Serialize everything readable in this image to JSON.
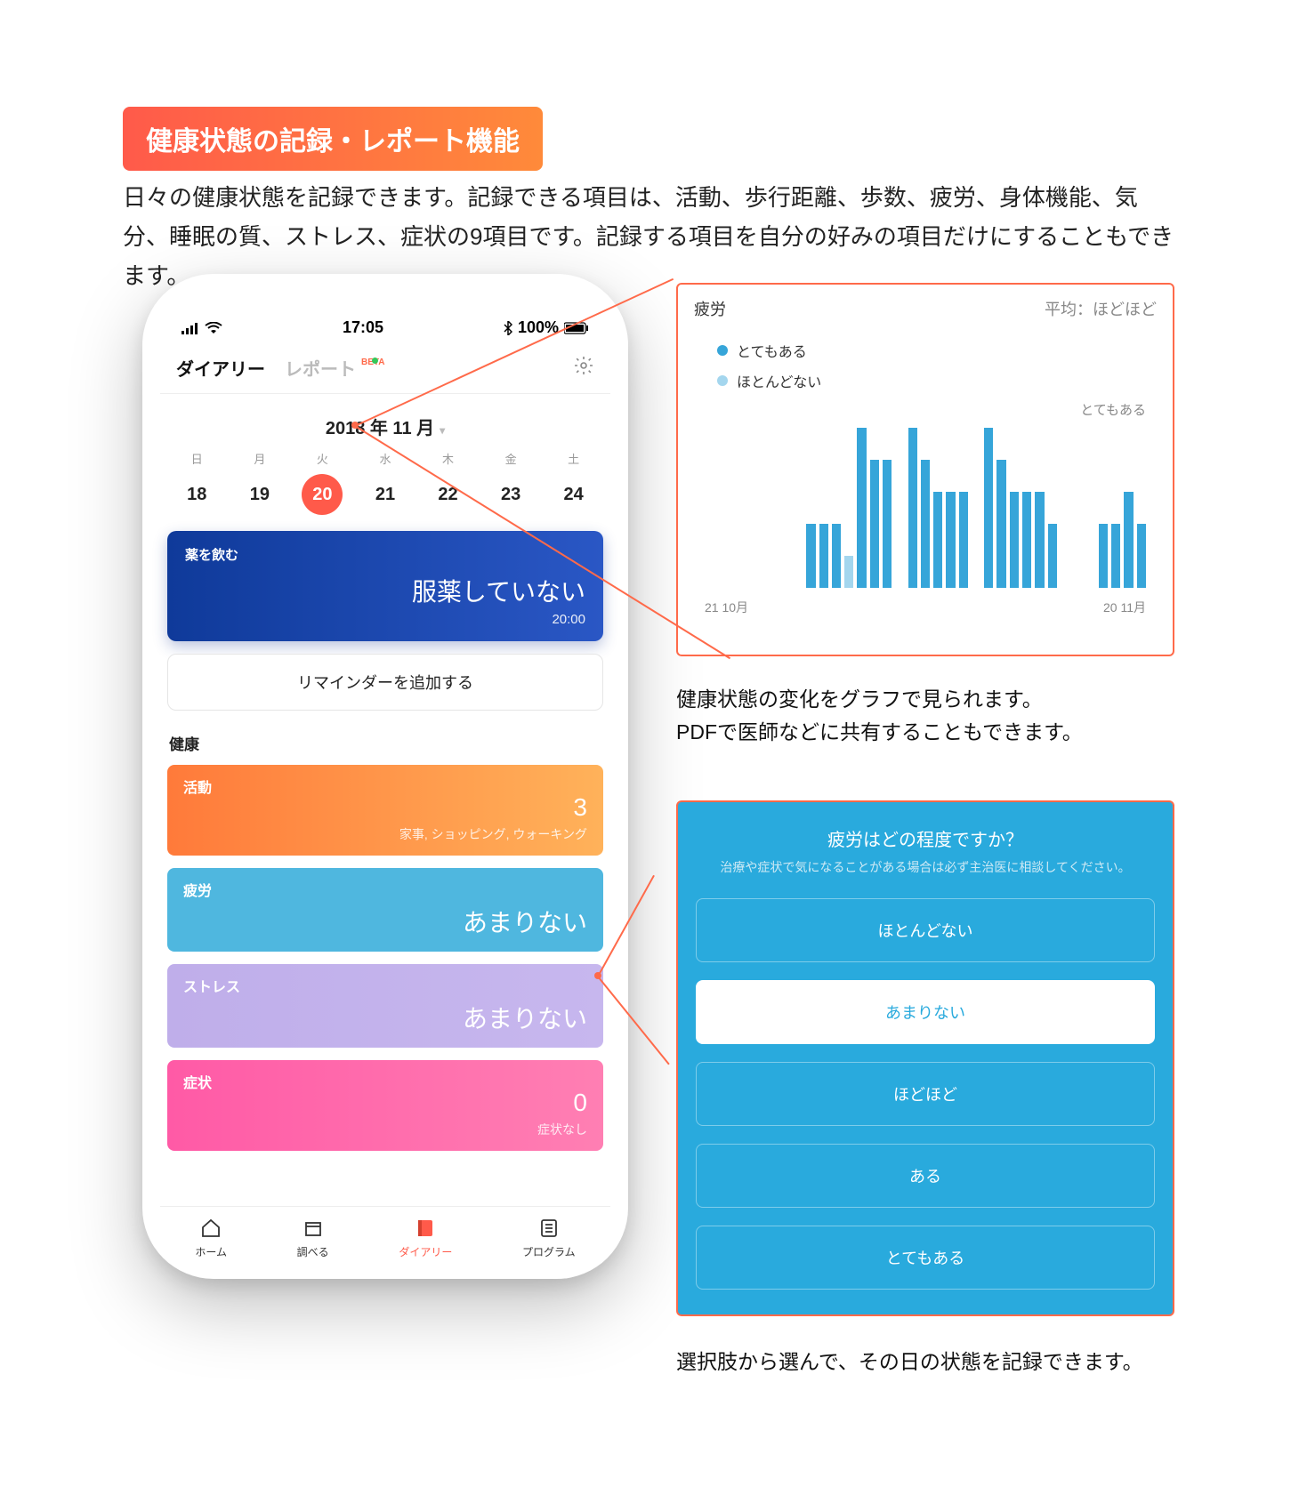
{
  "title": "健康状態の記録・レポート機能",
  "intro": "日々の健康状態を記録できます。記録できる項目は、活動、歩行距離、歩数、疲労、身体機能、気分、睡眠の質、ストレス、症状の9項目です。記録する項目を自分の好みの項目だけにすることもできます。",
  "status": {
    "time": "17:05",
    "battery": "100%"
  },
  "tabs": {
    "diary": "ダイアリー",
    "report": "レポート",
    "beta": "BETA"
  },
  "month": "2018 年 11 月",
  "weekdays": [
    "日",
    "月",
    "火",
    "水",
    "木",
    "金",
    "土"
  ],
  "days": [
    18,
    19,
    20,
    21,
    22,
    23,
    24
  ],
  "selected_day_index": 2,
  "med": {
    "label": "薬を飲む",
    "status": "服薬していない",
    "time": "20:00"
  },
  "reminder_btn": "リマインダーを追加する",
  "section_health": "健康",
  "cards": {
    "activity": {
      "title": "活動",
      "value": "3",
      "sub": "家事, ショッピング, ウォーキング"
    },
    "fatigue": {
      "title": "疲労",
      "value": "あまりない"
    },
    "stress": {
      "title": "ストレス",
      "value": "あまりない"
    },
    "symptom": {
      "title": "症状",
      "value": "0",
      "sub": "症状なし"
    }
  },
  "nav": {
    "home": "ホーム",
    "search": "調べる",
    "diary": "ダイアリー",
    "program": "プログラム"
  },
  "chart_panel": {
    "title": "疲労",
    "avg_label": "平均：ほどほど",
    "legend_high": "とてもある",
    "legend_low": "ほとんどない",
    "max_label": "とてもある",
    "x_start": "21 10月",
    "x_end": "20 11月",
    "caption": "健康状態の変化をグラフで見られます。\nPDFで医師などに共有することもできます。"
  },
  "chart_data": {
    "type": "bar",
    "title": "疲労",
    "ylabel": "",
    "ylim": [
      0,
      5
    ],
    "y_scale_labels": {
      "0": "ほとんどない",
      "5": "とてもある"
    },
    "x_start": "21 10月",
    "x_end": "20 11月",
    "series": [
      {
        "name": "とてもある",
        "color": "#36a5d9",
        "values": [
          null,
          null,
          null,
          null,
          null,
          null,
          null,
          null,
          2,
          2,
          2,
          1,
          5,
          4,
          4,
          null,
          5,
          4,
          3,
          3,
          3,
          null,
          5,
          4,
          3,
          3,
          3,
          2,
          null,
          null,
          null,
          2,
          2,
          3,
          2
        ]
      },
      {
        "name": "ほとんどない",
        "color": "#a4d6ee",
        "values": [
          null,
          null,
          null,
          null,
          null,
          null,
          null,
          null,
          null,
          null,
          null,
          null,
          null,
          null,
          null,
          null,
          null,
          null,
          null,
          null,
          null,
          null,
          null,
          null,
          null,
          null,
          null,
          null,
          null,
          null,
          null,
          null,
          null,
          null,
          null
        ]
      }
    ]
  },
  "question": {
    "title": "疲労はどの程度ですか？",
    "note": "治療や症状で気になることがある場合は必ず主治医に相談してください。",
    "options": [
      "ほとんどない",
      "あまりない",
      "ほどほど",
      "ある",
      "とてもある"
    ],
    "selected_index": 1,
    "caption": "選択肢から選んで、その日の状態を記録できます。"
  }
}
